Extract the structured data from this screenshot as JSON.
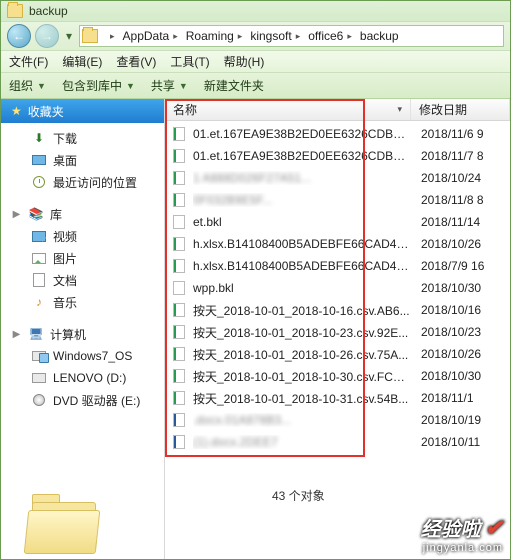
{
  "window": {
    "title": "backup"
  },
  "nav": {
    "back_glyph": "←",
    "fwd_glyph": "→"
  },
  "breadcrumb": [
    {
      "label": "AppData"
    },
    {
      "label": "Roaming"
    },
    {
      "label": "kingsoft"
    },
    {
      "label": "office6"
    },
    {
      "label": "backup"
    }
  ],
  "menubar": [
    {
      "label": "文件(F)"
    },
    {
      "label": "编辑(E)"
    },
    {
      "label": "查看(V)"
    },
    {
      "label": "工具(T)"
    },
    {
      "label": "帮助(H)"
    }
  ],
  "toolbar": {
    "organize": "组织",
    "include": "包含到库中",
    "share": "共享",
    "newfolder": "新建文件夹"
  },
  "sidebar": {
    "favorites": "收藏夹",
    "fav_items": [
      {
        "label": "下载",
        "icon": "download-icon"
      },
      {
        "label": "桌面",
        "icon": "desktop-icon"
      },
      {
        "label": "最近访问的位置",
        "icon": "recent-icon"
      }
    ],
    "libraries": "库",
    "lib_items": [
      {
        "label": "视频",
        "icon": "video-icon"
      },
      {
        "label": "图片",
        "icon": "picture-icon"
      },
      {
        "label": "文档",
        "icon": "document-icon"
      },
      {
        "label": "音乐",
        "icon": "music-icon"
      }
    ],
    "computer": "计算机",
    "drives": [
      {
        "label": "Windows7_OS",
        "icon": "drive-c-icon"
      },
      {
        "label": "LENOVO (D:)",
        "icon": "drive-icon"
      },
      {
        "label": "DVD 驱动器 (E:)",
        "icon": "dvd-icon"
      }
    ]
  },
  "columns": {
    "name": "名称",
    "date": "修改日期"
  },
  "files": [
    {
      "name": "01.et.167EA9E38B2ED0EE6326CDBF7...",
      "date": "2018/11/6 9",
      "icon": "et"
    },
    {
      "name": "01.et.167EA9E38B2ED0EE6326CDBF7...",
      "date": "2018/11/7 8",
      "icon": "et"
    },
    {
      "name": "1                       A888D026F27A51...",
      "date": "2018/10/24",
      "icon": "et",
      "blur": true
    },
    {
      "name": "                              0F032B9E5F...",
      "date": "2018/11/8 8",
      "icon": "et",
      "blur": true
    },
    {
      "name": "et.bkl",
      "date": "2018/11/14",
      "icon": "file"
    },
    {
      "name": "h.xlsx.B14108400B5ADEBFE66CAD49...",
      "date": "2018/10/26",
      "icon": "et"
    },
    {
      "name": "h.xlsx.B14108400B5ADEBFE66CAD49...",
      "date": "2018/7/9 16",
      "icon": "et"
    },
    {
      "name": "wpp.bkl",
      "date": "2018/10/30",
      "icon": "file"
    },
    {
      "name": "按天_2018-10-01_2018-10-16.csv.AB6...",
      "date": "2018/10/16",
      "icon": "et"
    },
    {
      "name": "按天_2018-10-01_2018-10-23.csv.92E...",
      "date": "2018/10/23",
      "icon": "et"
    },
    {
      "name": "按天_2018-10-01_2018-10-26.csv.75A...",
      "date": "2018/10/26",
      "icon": "et"
    },
    {
      "name": "按天_2018-10-01_2018-10-30.csv.FCD...",
      "date": "2018/10/30",
      "icon": "et"
    },
    {
      "name": "按天_2018-10-01_2018-10-31.csv.54B...",
      "date": "2018/11/1",
      "icon": "et"
    },
    {
      "name": "                        .docx.01A878B3...",
      "date": "2018/10/19",
      "icon": "docx",
      "blur": true
    },
    {
      "name": "                        (1).docx.2DEE7",
      "date": "2018/10/11",
      "icon": "docx",
      "blur": true
    }
  ],
  "status": {
    "count": "43 个对象"
  },
  "watermark": {
    "brand": "经验啦",
    "url": "jingyanla.com"
  }
}
